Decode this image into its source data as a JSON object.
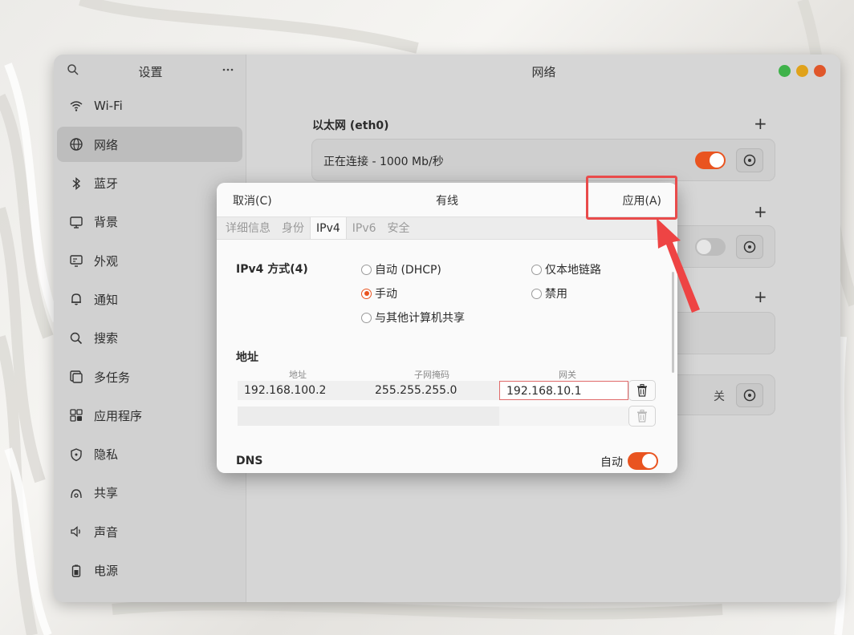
{
  "sidebar": {
    "title": "设置",
    "items": [
      {
        "label": "Wi-Fi",
        "icon": "wifi-icon"
      },
      {
        "label": "网络",
        "icon": "globe-icon",
        "active": true
      },
      {
        "label": "蓝牙",
        "icon": "bluetooth-icon"
      },
      {
        "label": "背景",
        "icon": "monitor-icon"
      },
      {
        "label": "外观",
        "icon": "appearance-icon"
      },
      {
        "label": "通知",
        "icon": "bell-icon"
      },
      {
        "label": "搜索",
        "icon": "search-icon"
      },
      {
        "label": "多任务",
        "icon": "multitask-icon"
      },
      {
        "label": "应用程序",
        "icon": "apps-icon"
      },
      {
        "label": "隐私",
        "icon": "shield-icon"
      },
      {
        "label": "共享",
        "icon": "share-icon"
      },
      {
        "label": "声音",
        "icon": "speaker-icon"
      },
      {
        "label": "电源",
        "icon": "battery-icon"
      }
    ]
  },
  "main": {
    "title": "网络",
    "ethernet": {
      "title": "以太网 (eth0)",
      "status": "正在连接 - 1000 Mb/秒",
      "enabled": true
    },
    "off_label": "关"
  },
  "dialog": {
    "cancel": "取消(C)",
    "title": "有线",
    "apply": "应用(A)",
    "tabs": [
      "详细信息",
      "身份",
      "IPv4",
      "IPv6",
      "安全"
    ],
    "active_tab": "IPv4",
    "method_label": "IPv4 方式(4)",
    "methods": {
      "dhcp": "自动 (DHCP)",
      "link_local": "仅本地链路",
      "manual": "手动",
      "disabled": "禁用",
      "shared": "与其他计算机共享"
    },
    "selected_method": "manual",
    "address_title": "地址",
    "columns": {
      "address": "地址",
      "netmask": "子网掩码",
      "gateway": "网关"
    },
    "rows": [
      {
        "address": "192.168.100.2",
        "netmask": "255.255.255.0",
        "gateway": "192.168.10.1"
      }
    ],
    "dns_label": "DNS",
    "dns_auto_label": "自动",
    "dns_auto": true
  },
  "colors": {
    "accent": "#e95420",
    "highlight": "#e94b4b",
    "close": "#e0572b",
    "minimize": "#e0a21b",
    "maximize": "#3fb24a"
  }
}
